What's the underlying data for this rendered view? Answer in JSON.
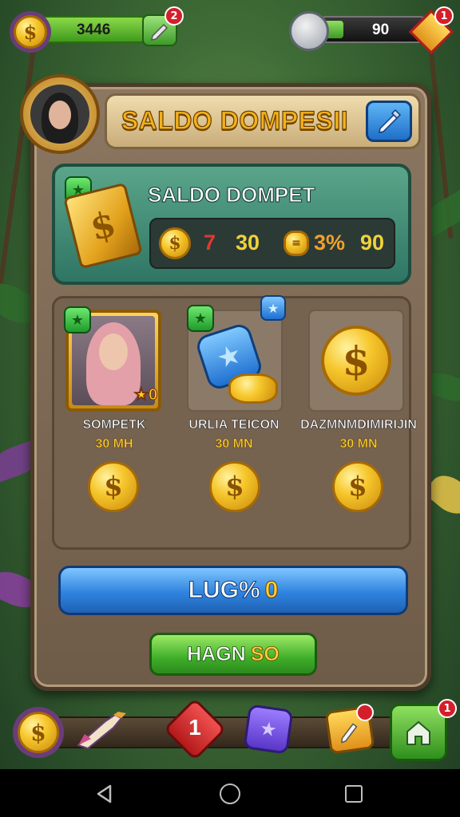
{
  "hud": {
    "left_counter": "3446",
    "left_badge": "2",
    "right_counter": "90",
    "right_badge": "1"
  },
  "panel": {
    "title": "SALDO DOMPESII"
  },
  "wallet": {
    "title": "SALDO DOMPET",
    "stat_a": "7",
    "stat_b": "30",
    "stat_c": "3%",
    "stat_d": "90"
  },
  "shop": {
    "items": [
      {
        "name": "SOMPETK",
        "price": "30 MH",
        "tag": "0"
      },
      {
        "name": "URLIA TEICON",
        "price": "30 MN"
      },
      {
        "name": "DAZMNMDIMIRIJIN",
        "price": "30 MN"
      }
    ]
  },
  "buttons": {
    "primary_label": "LUG%",
    "primary_value": "0",
    "secondary_label": "HAGN",
    "secondary_value": "SO"
  },
  "bottom": {
    "center_badge": "1",
    "right_badge": "1"
  },
  "colors": {
    "accent_gold": "#f2b21b",
    "panel_brown": "#8c7761",
    "wallet_green": "#3f8a74",
    "primary_blue": "#2f83df",
    "secondary_green": "#3fae2a"
  }
}
